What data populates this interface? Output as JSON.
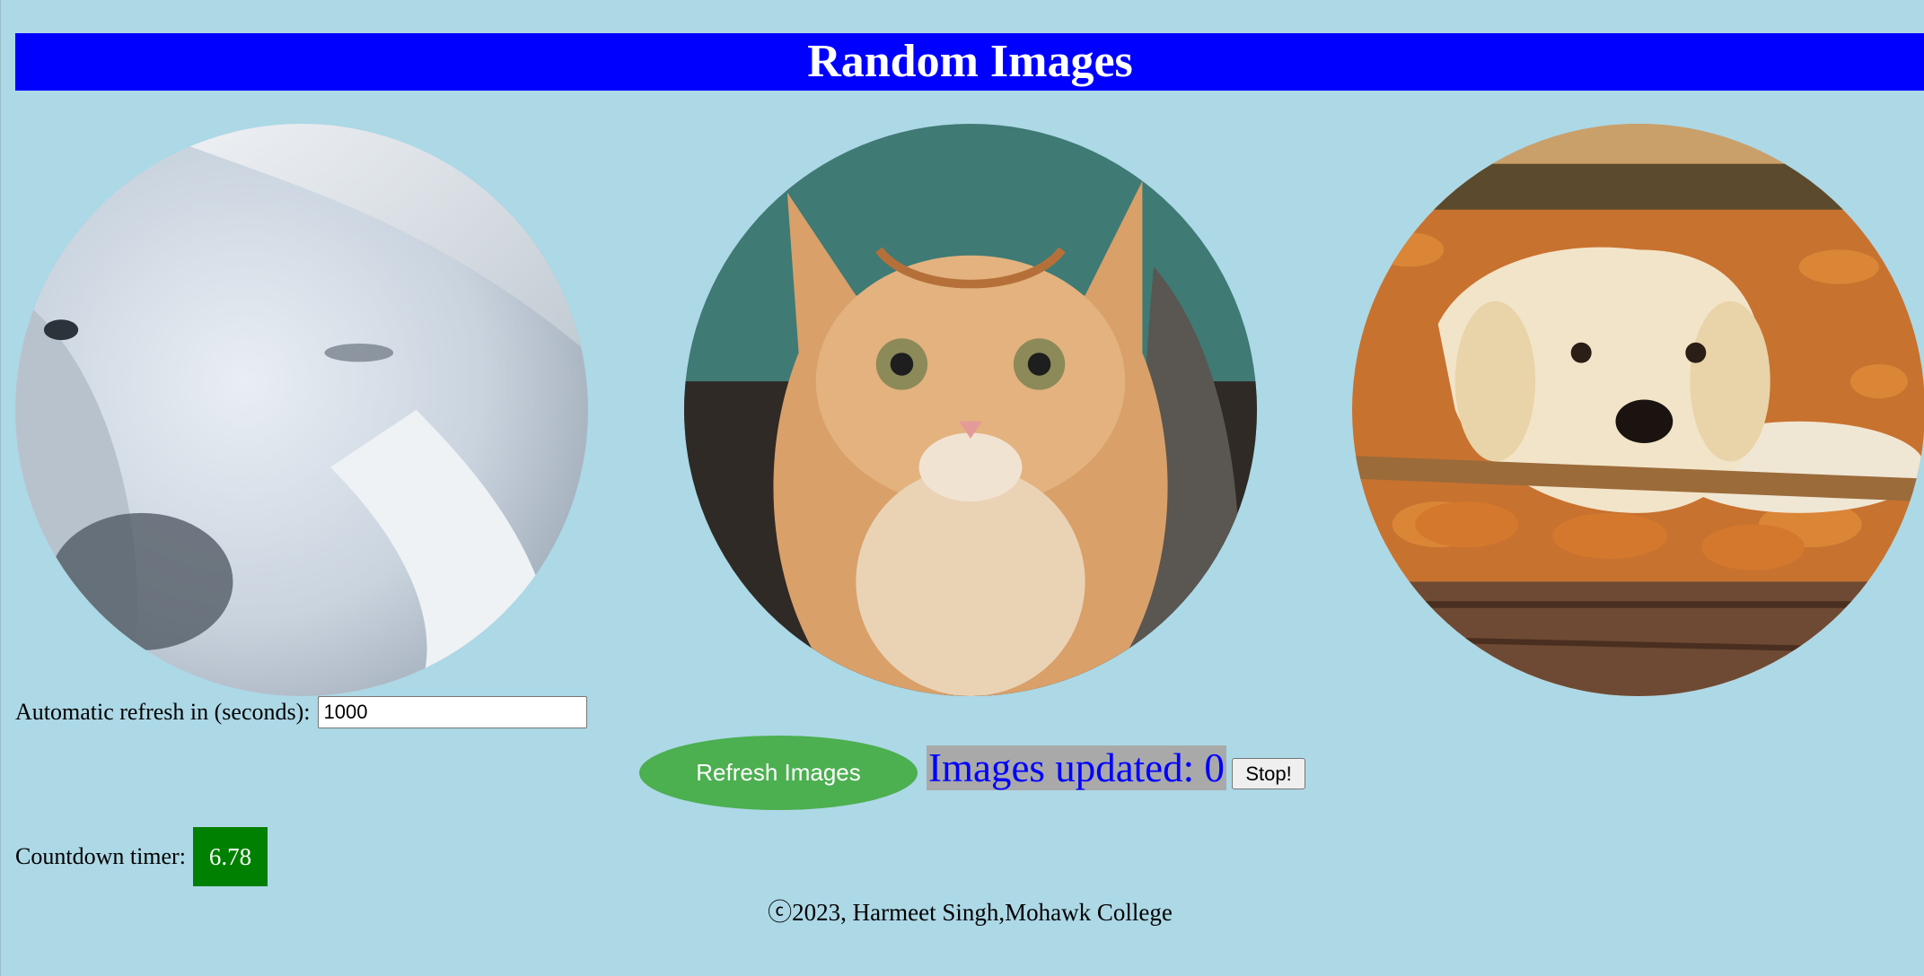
{
  "header": {
    "title": "Random Images"
  },
  "images": [
    {
      "subject": "white horse"
    },
    {
      "subject": "orange tabby kitten"
    },
    {
      "subject": "golden retriever puppy in autumn leaves"
    }
  ],
  "controls": {
    "refresh_label": "Automatic refresh in (seconds):",
    "refresh_value": "1000",
    "refresh_button": "Refresh Images",
    "updated_text": "Images updated: 0",
    "stop_button": "Stop!",
    "countdown_label": "Countdown timer:",
    "countdown_value": "6.78"
  },
  "footer": {
    "text": "ⓒ2023, Harmeet Singh,Mohawk College"
  },
  "colors": {
    "background": "#add8e6",
    "header": "#0000ff",
    "refresh_button": "#4caf50",
    "countdown": "#008000",
    "updated_text": "#0000ff",
    "updated_bg": "#a9a9a9"
  }
}
